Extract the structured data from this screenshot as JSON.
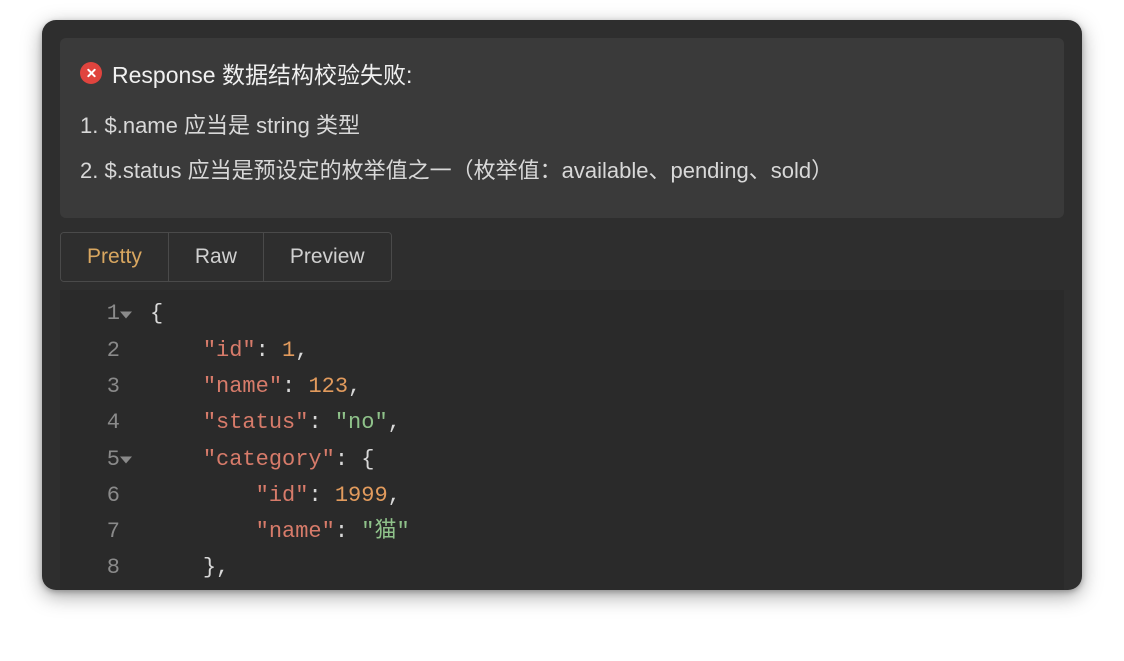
{
  "error": {
    "title": "Response 数据结构校验失败:",
    "items": [
      "$.name 应当是 string 类型",
      "$.status 应当是预设定的枚举值之一（枚举值：available、pending、sold）"
    ]
  },
  "tabs": {
    "items": [
      "Pretty",
      "Raw",
      "Preview"
    ],
    "active": "Pretty"
  },
  "code": {
    "json": {
      "id": 1,
      "name": 123,
      "status": "no",
      "category": {
        "id": 1999,
        "name": "猫"
      }
    },
    "lines": [
      {
        "n": 1,
        "fold": true,
        "indent": 0,
        "tokens": [
          [
            "punct",
            "{"
          ]
        ]
      },
      {
        "n": 2,
        "fold": false,
        "indent": 1,
        "tokens": [
          [
            "key",
            "\"id\""
          ],
          [
            "punct",
            ": "
          ],
          [
            "num",
            "1"
          ],
          [
            "punct",
            ","
          ]
        ]
      },
      {
        "n": 3,
        "fold": false,
        "indent": 1,
        "tokens": [
          [
            "key",
            "\"name\""
          ],
          [
            "punct",
            ": "
          ],
          [
            "num",
            "123"
          ],
          [
            "punct",
            ","
          ]
        ]
      },
      {
        "n": 4,
        "fold": false,
        "indent": 1,
        "tokens": [
          [
            "key",
            "\"status\""
          ],
          [
            "punct",
            ": "
          ],
          [
            "str",
            "\"no\""
          ],
          [
            "punct",
            ","
          ]
        ]
      },
      {
        "n": 5,
        "fold": true,
        "indent": 1,
        "tokens": [
          [
            "key",
            "\"category\""
          ],
          [
            "punct",
            ": {"
          ]
        ]
      },
      {
        "n": 6,
        "fold": false,
        "indent": 2,
        "tokens": [
          [
            "key",
            "\"id\""
          ],
          [
            "punct",
            ": "
          ],
          [
            "num",
            "1999"
          ],
          [
            "punct",
            ","
          ]
        ]
      },
      {
        "n": 7,
        "fold": false,
        "indent": 2,
        "tokens": [
          [
            "key",
            "\"name\""
          ],
          [
            "punct",
            ": "
          ],
          [
            "str",
            "\"猫\""
          ]
        ]
      },
      {
        "n": 8,
        "fold": false,
        "indent": 1,
        "tokens": [
          [
            "punct",
            "},"
          ]
        ]
      }
    ]
  },
  "colors": {
    "accent": "#d9a760",
    "error": "#e0443e",
    "key": "#d77b6a",
    "number": "#e29b5d",
    "string": "#8fc28a"
  }
}
